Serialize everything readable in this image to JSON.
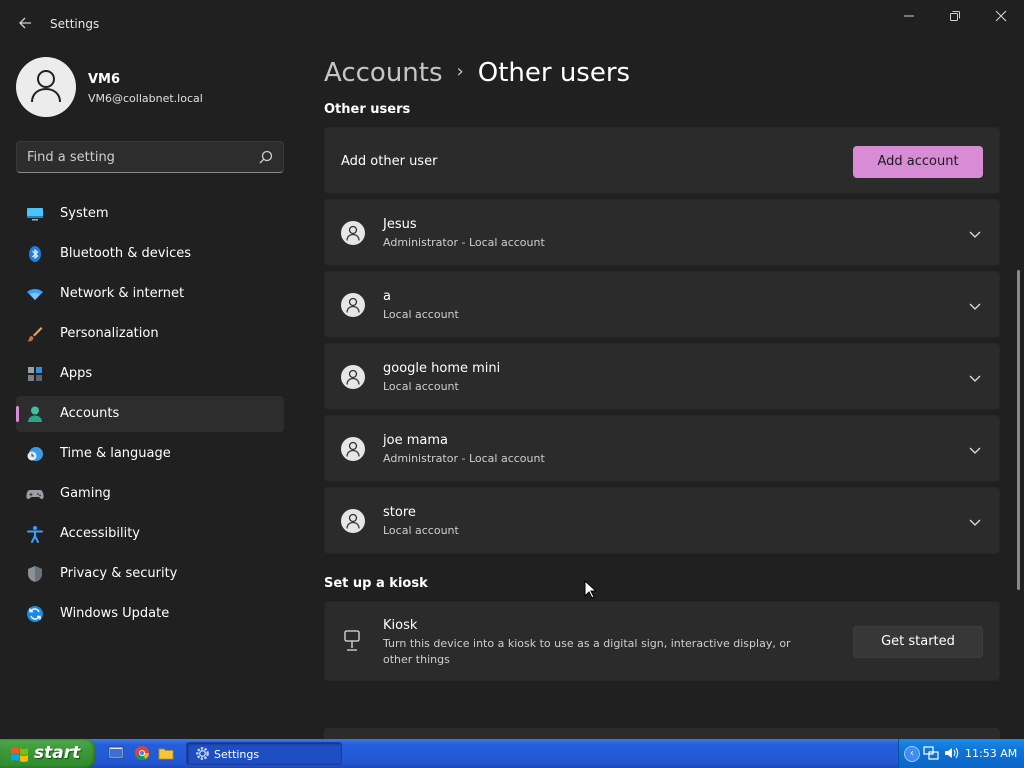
{
  "window": {
    "title": "Settings"
  },
  "profile": {
    "name": "VM6",
    "email": "VM6@collabnet.local"
  },
  "search": {
    "placeholder": "Find a setting"
  },
  "nav": {
    "items": [
      {
        "label": "System",
        "icon": "system-icon"
      },
      {
        "label": "Bluetooth & devices",
        "icon": "bluetooth-icon"
      },
      {
        "label": "Network & internet",
        "icon": "wifi-icon"
      },
      {
        "label": "Personalization",
        "icon": "brush-icon"
      },
      {
        "label": "Apps",
        "icon": "apps-icon"
      },
      {
        "label": "Accounts",
        "icon": "accounts-icon",
        "active": true
      },
      {
        "label": "Time & language",
        "icon": "clock-globe-icon"
      },
      {
        "label": "Gaming",
        "icon": "gamepad-icon"
      },
      {
        "label": "Accessibility",
        "icon": "accessibility-icon"
      },
      {
        "label": "Privacy & security",
        "icon": "shield-icon"
      },
      {
        "label": "Windows Update",
        "icon": "update-icon"
      }
    ]
  },
  "breadcrumb": {
    "parent": "Accounts",
    "current": "Other users"
  },
  "other_users": {
    "section_title": "Other users",
    "add_label": "Add other user",
    "add_button": "Add account",
    "users": [
      {
        "name": "Jesus",
        "type": "Administrator - Local account"
      },
      {
        "name": "a",
        "type": "Local account"
      },
      {
        "name": "google home mini",
        "type": "Local account"
      },
      {
        "name": "joe mama",
        "type": "Administrator - Local account"
      },
      {
        "name": "store",
        "type": "Local account"
      }
    ]
  },
  "kiosk": {
    "section_title": "Set up a kiosk",
    "title": "Kiosk",
    "description": "Turn this device into a kiosk to use as a digital sign, interactive display, or other things",
    "button": "Get started"
  },
  "taskbar": {
    "start_label": "start",
    "task_label": "Settings",
    "clock": "11:53 AM"
  },
  "colors": {
    "accent": "#d88cd6",
    "background": "#202020",
    "card": "#2b2b2b",
    "taskbar": "#245edb",
    "start": "#3b9a38"
  }
}
